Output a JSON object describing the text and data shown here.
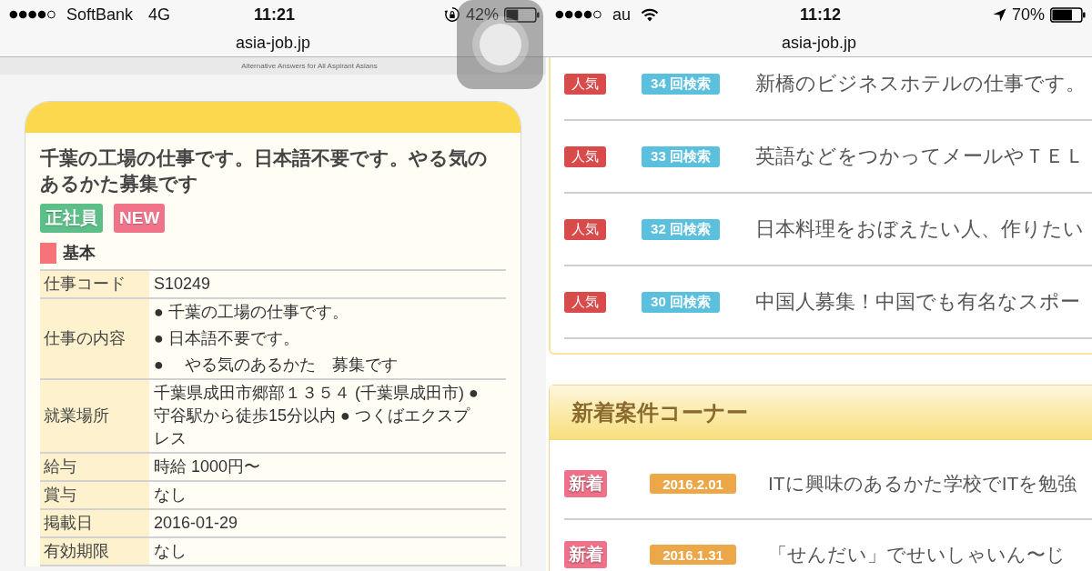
{
  "screens": [
    {
      "status_bar": {
        "left": [
          {
            "kind": "signal"
          },
          {
            "kind": "carrier",
            "text": "SoftBank"
          },
          {
            "kind": "network",
            "text": "4G"
          }
        ],
        "time": "11:21",
        "right": [
          {
            "kind": "rotation_lock"
          },
          {
            "kind": "battery_percent",
            "text": "42%"
          },
          {
            "kind": "battery"
          }
        ]
      },
      "address_bar": "asia-job.jp",
      "assistive_touch": true,
      "site_header": {
        "tagline": "Alternative Answers for All Aspirant Asians"
      },
      "job": {
        "title": "千葉の工場の仕事です。日本語不要です。やる気のあるかた募集です",
        "tags": [
          {
            "label": "正社員",
            "color": "#5cbf87"
          },
          {
            "label": "NEW",
            "color": "#f0738a"
          }
        ],
        "section": "基本",
        "details": [
          {
            "label": "仕事コード",
            "value": "S10249"
          },
          {
            "label": "仕事の内容",
            "items": [
              "● 千葉の工場の仕事です。",
              "● 日本語不要です。",
              "● 　やる気のあるかた　募集です"
            ]
          },
          {
            "label": "就業場所",
            "value": "千葉県成田市郷部１３５４ (千葉県成田市) ● 守谷駅から徒歩15分以内 ● つくばエクスプレス"
          },
          {
            "label": "給与",
            "value": "時給 1000円〜"
          },
          {
            "label": "賞与",
            "value": "なし"
          },
          {
            "label": "掲載日",
            "value": "2016-01-29"
          },
          {
            "label": "有効期限",
            "value": "なし"
          }
        ]
      }
    },
    {
      "status_bar": {
        "left": [
          {
            "kind": "signal"
          },
          {
            "kind": "carrier",
            "text": "au"
          },
          {
            "kind": "wifi"
          }
        ],
        "time": "11:12",
        "right": [
          {
            "kind": "location"
          },
          {
            "kind": "battery_percent",
            "text": "70%"
          },
          {
            "kind": "battery"
          }
        ]
      },
      "address_bar": "asia-job.jp",
      "popular_jobs": {
        "rows": [
          {
            "badge": "人気",
            "count": "34 回検索",
            "title": "新橋のビジネスホテルの仕事です。"
          },
          {
            "badge": "人気",
            "count": "33 回検索",
            "title": "英語などをつかってメールやＴＥＬ"
          },
          {
            "badge": "人気",
            "count": "32 回検索",
            "title": "日本料理をおぼえたい人、作りたい"
          },
          {
            "badge": "人気",
            "count": "30 回検索",
            "title": "中国人募集！中国でも有名なスポー"
          }
        ]
      },
      "new_listings": {
        "heading": "新着案件コーナー",
        "rows": [
          {
            "badge": "新着",
            "date": "2016.2.01",
            "title": "ITに興味のあるかた学校でITを勉強"
          },
          {
            "badge": "新着",
            "date": "2016.1.31",
            "title": "「せんだい」でせいしゃいん〜じ"
          }
        ]
      }
    }
  ]
}
